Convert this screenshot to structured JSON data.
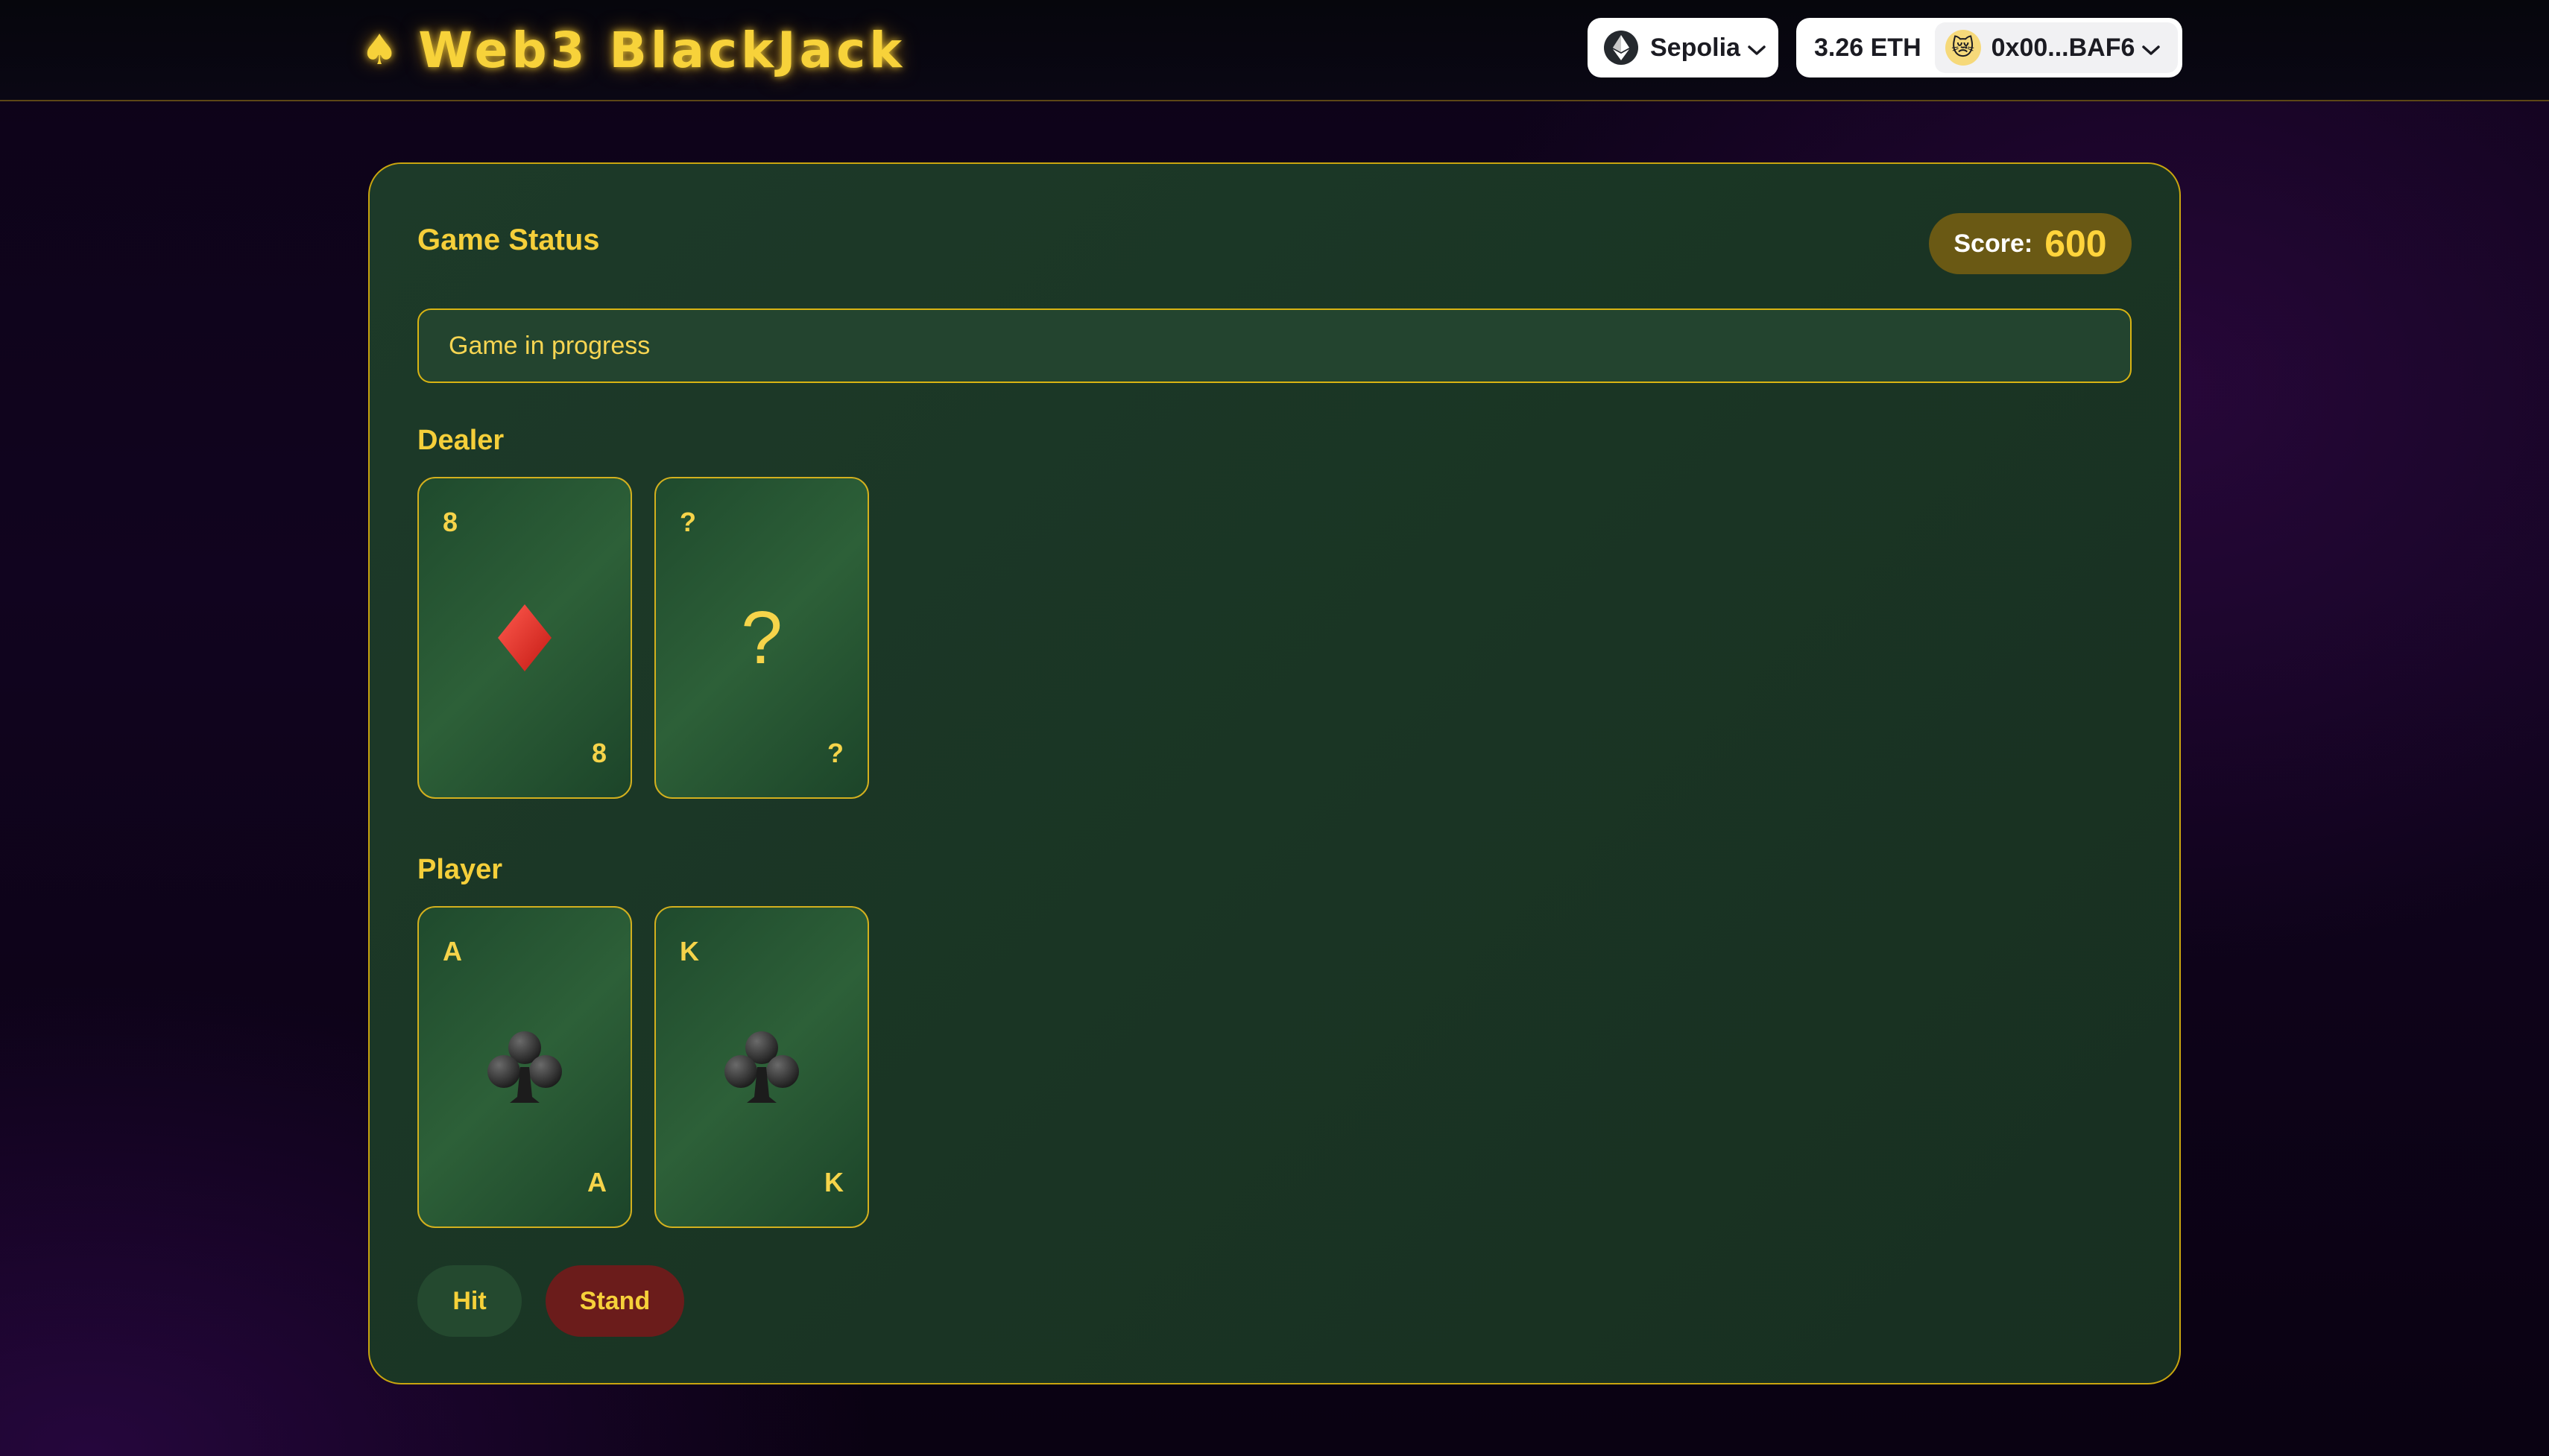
{
  "header": {
    "brand_icon": "♠",
    "brand": "Web3 BlackJack",
    "network": {
      "name": "Sepolia",
      "icon": "ethereum-icon"
    },
    "account": {
      "balance": "3.26 ETH",
      "address": "0x00...BAF6",
      "avatar_icon": "😿"
    }
  },
  "game": {
    "status_title": "Game Status",
    "score_label": "Score:",
    "score_value": "600",
    "message": "Game in progress",
    "dealer": {
      "label": "Dealer",
      "cards": [
        {
          "rank": "8",
          "suit": "diamonds"
        },
        {
          "rank": "?",
          "suit": "hidden"
        }
      ]
    },
    "player": {
      "label": "Player",
      "cards": [
        {
          "rank": "A",
          "suit": "clubs"
        },
        {
          "rank": "K",
          "suit": "clubs"
        }
      ]
    },
    "actions": {
      "hit": "Hit",
      "stand": "Stand"
    }
  },
  "colors": {
    "accent_gold": "#f5cf3a",
    "felt_green": "#1a3524",
    "stand_red": "#6b1c1b",
    "diamond_red": "#e02a22"
  }
}
